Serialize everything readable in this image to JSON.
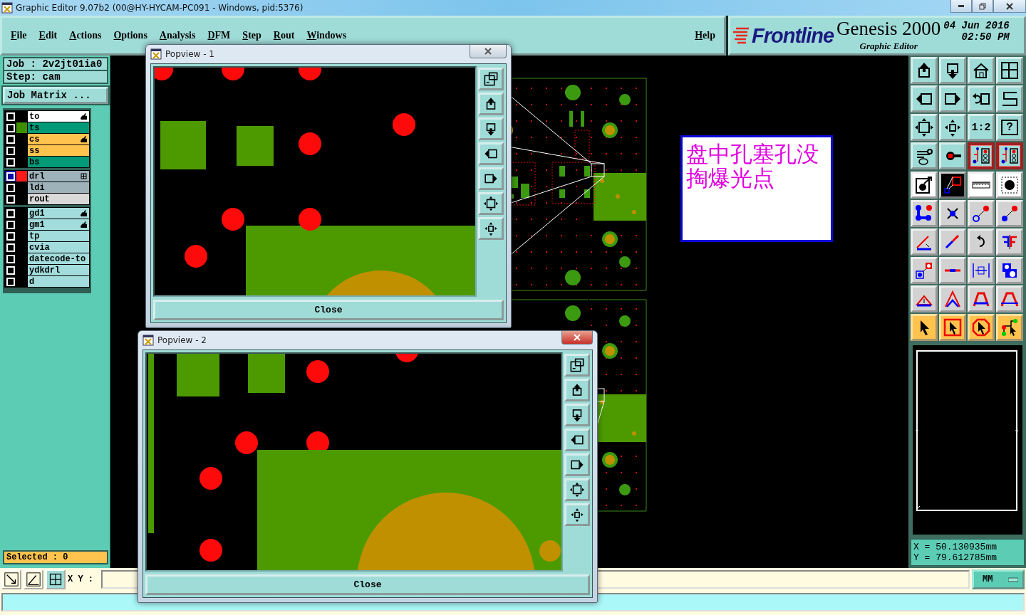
{
  "window": {
    "title": "Graphic Editor 9.07b2 (00@HY-HYCAM-PC091 - Windows, pid:5376)"
  },
  "menu": [
    {
      "label": "File"
    },
    {
      "label": "Edit"
    },
    {
      "label": "Actions"
    },
    {
      "label": "Options"
    },
    {
      "label": "Analysis"
    },
    {
      "label": "DFM"
    },
    {
      "label": "Step"
    },
    {
      "label": "Rout"
    },
    {
      "label": "Windows"
    }
  ],
  "help_menu": {
    "label": "Help"
  },
  "logo": {
    "brand": "Frontline",
    "product": "Genesis 2000",
    "subtitle": "Graphic Editor",
    "date": "04 Jun 2016",
    "time": "02:50 PM"
  },
  "job": {
    "job": "Job : 2v2jt01ia0",
    "step": "Step: cam",
    "matrix_button": "Job Matrix ..."
  },
  "layer_groups": [
    {
      "layers": [
        {
          "name": "to",
          "color": "#ffffff",
          "selected": false,
          "pointer_mark": true,
          "grid_mark": false
        },
        {
          "name": "ts",
          "color": "#009a78",
          "swatch": {
            "color": "#3d8f00"
          },
          "selected": false,
          "pointer_mark": false,
          "grid_mark": false
        },
        {
          "name": "cs",
          "color": "#ffc34e",
          "selected": false,
          "pointer_mark": true,
          "grid_mark": false
        },
        {
          "name": "ss",
          "color": "#ffc34e",
          "selected": false,
          "pointer_mark": false,
          "grid_mark": false
        },
        {
          "name": "bs",
          "color": "#009a78",
          "selected": false,
          "pointer_mark": false,
          "grid_mark": false
        }
      ]
    },
    {
      "layers": [
        {
          "name": "drl",
          "color": "#9eb2ba",
          "swatch": {
            "color": "#ff1a1a"
          },
          "selected": true,
          "pointer_mark": false,
          "grid_mark": true
        },
        {
          "name": "ldi",
          "color": "#9eb2ba",
          "selected": false,
          "pointer_mark": false,
          "grid_mark": false
        },
        {
          "name": "rout",
          "color": "#d9d9d9",
          "selected": false,
          "pointer_mark": false,
          "grid_mark": false
        }
      ]
    },
    {
      "layers": [
        {
          "name": "gd1",
          "color": "#a3dcdc",
          "selected": false,
          "pointer_mark": true,
          "grid_mark": false
        },
        {
          "name": "gm1",
          "color": "#a3dcdc",
          "selected": false,
          "pointer_mark": true,
          "grid_mark": false
        },
        {
          "name": "tp",
          "color": "#a3dcdc",
          "selected": false,
          "pointer_mark": false,
          "grid_mark": false
        },
        {
          "name": "cvia",
          "color": "#a3dcdc",
          "selected": false,
          "pointer_mark": false,
          "grid_mark": false
        },
        {
          "name": "datecode-to",
          "color": "#a3dcdc",
          "selected": false,
          "pointer_mark": false,
          "grid_mark": false
        },
        {
          "name": "ydkdrl",
          "color": "#a3dcdc",
          "selected": false,
          "pointer_mark": false,
          "grid_mark": false
        },
        {
          "name": "d",
          "color": "#a3dcdc",
          "selected": false,
          "pointer_mark": false,
          "grid_mark": false
        }
      ]
    }
  ],
  "selected_count": "Selected : 0",
  "note": {
    "text": "盘中孔塞孔没掏爆光点"
  },
  "toolbar": {
    "scale_label": "1:2",
    "help_label": "?"
  },
  "coords": {
    "x": "X = 50.130935mm",
    "y": "Y = 79.612785mm"
  },
  "bottom": {
    "xy_label": "X Y :",
    "units": "MM"
  },
  "popviews": [
    {
      "title": "Popview - 1",
      "close_label": "Close",
      "active": false
    },
    {
      "title": "Popview - 2",
      "close_label": "Close",
      "active": true
    }
  ]
}
